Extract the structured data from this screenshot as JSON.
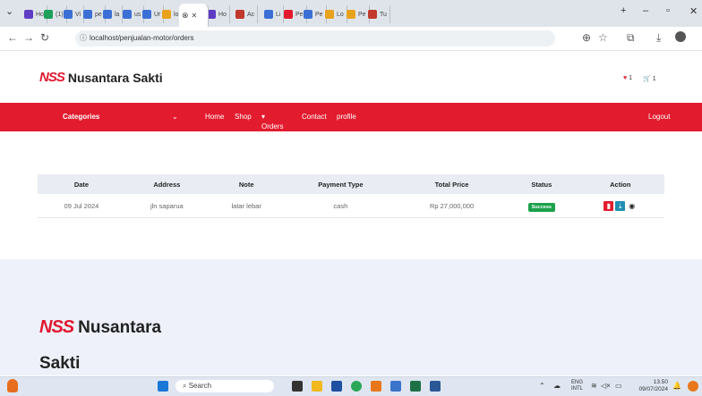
{
  "browser": {
    "tabs": [
      {
        "label": "Ho",
        "color": "#5f3dc4"
      },
      {
        "label": "(1)",
        "color": "#1ea05a"
      },
      {
        "label": "Vi",
        "color": "#3b6fd6"
      },
      {
        "label": "pe",
        "color": "#3b6fd6"
      },
      {
        "label": "la",
        "color": "#3b6fd6"
      },
      {
        "label": "us",
        "color": "#3b6fd6"
      },
      {
        "label": "Ur",
        "color": "#3b6fd6"
      },
      {
        "label": "lo",
        "color": "#e8a21c"
      },
      {
        "label": "Ho",
        "color": "#5f3dc4"
      },
      {
        "label": "Ac",
        "color": "#c0392b"
      },
      {
        "label": "Li",
        "color": "#3b6fd6"
      },
      {
        "label": "Pe",
        "color": "#e31b2e"
      },
      {
        "label": "Pe",
        "color": "#3b6fd6"
      },
      {
        "label": "Lo",
        "color": "#e8a21c"
      },
      {
        "label": "Pe",
        "color": "#e8a21c"
      },
      {
        "label": "Tu",
        "color": "#c0392b"
      }
    ],
    "url": "localhost/penjualan-motor/orders"
  },
  "site": {
    "logo": "NSS",
    "name": "Nusantara Sakti",
    "wishlist_count": "1",
    "cart_count": "1",
    "accent": "#e31b2e"
  },
  "menu": {
    "categories": "Categories",
    "items": [
      "Home",
      "Shop",
      "Orders",
      "Contact",
      "profile"
    ],
    "logout": "Logout"
  },
  "orders": {
    "headers": [
      "Date",
      "Address",
      "Note",
      "Payment Type",
      "Total Price",
      "Status",
      "Action"
    ],
    "rows": [
      {
        "date": "09 Jul 2024",
        "address": "jln saparua",
        "note": "latar lebar",
        "payment": "cash",
        "total": "Rp 27,000,000",
        "status": "Success"
      }
    ]
  },
  "footer": {
    "logo": "NSS",
    "name_line1": "Nusantara",
    "name_line2": "Sakti"
  },
  "taskbar": {
    "search": "Search",
    "lang1": "ENG",
    "lang2": "INTL",
    "time": "13.50",
    "date": "09/07/2024"
  }
}
